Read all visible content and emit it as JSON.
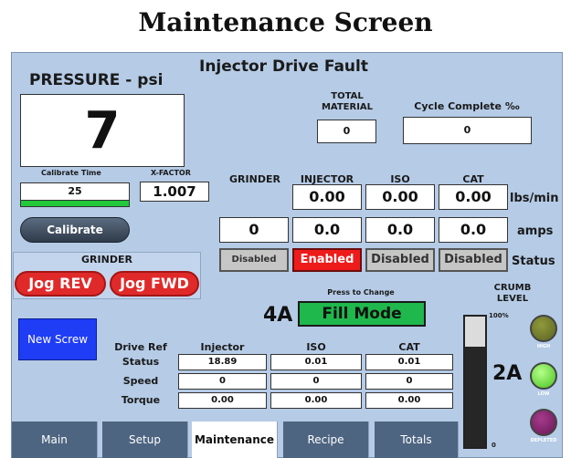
{
  "page_title": "Maintenance Screen",
  "fault": "Injector Drive Fault",
  "pressure": {
    "label": "PRESSURE - psi",
    "value": "7"
  },
  "calibrate_time": {
    "label": "Calibrate Time",
    "value": "25"
  },
  "xfactor": {
    "label": "X-FACTOR",
    "value": "1.007"
  },
  "calibrate_button": "Calibrate",
  "total_material": {
    "label_line1": "TOTAL",
    "label_line2": "MATERIAL",
    "value": "0"
  },
  "cycle_complete": {
    "label": "Cycle Complete ‰",
    "value": "0"
  },
  "columns": [
    "GRINDER",
    "INJECTOR",
    "ISO",
    "CAT"
  ],
  "rates": {
    "injector": "0.00",
    "iso": "0.00",
    "cat": "0.00",
    "unit": "lbs/min"
  },
  "amps": {
    "grinder": "0",
    "injector": "0.0",
    "iso": "0.0",
    "cat": "0.0",
    "unit": "amps"
  },
  "statuses": {
    "grinder": "Disabled",
    "injector": "Enabled",
    "iso": "Disabled",
    "cat": "Disabled",
    "label": "Status"
  },
  "grinder_panel": {
    "title": "GRINDER",
    "jog_rev": "Jog REV",
    "jog_fwd": "Jog FWD"
  },
  "press_to_change": "Press to Change",
  "mode_button": "Fill Mode",
  "callouts": {
    "a4": "4A",
    "a2": "2A"
  },
  "crumb": {
    "label_line1": "CRUMB",
    "label_line2": "LEVEL",
    "top": "100%",
    "bottom": "0",
    "fill_fraction": 0.77,
    "high": "HIGH",
    "low": "LOW",
    "depleted": "DEPLETED"
  },
  "new_screw": "New Screw",
  "drive_table": {
    "corner": "Drive Ref",
    "headers": [
      "Injector",
      "ISO",
      "CAT"
    ],
    "rows": [
      {
        "label": "Status",
        "values": [
          "18.89",
          "0.01",
          "0.01"
        ]
      },
      {
        "label": "Speed",
        "values": [
          "0",
          "0",
          "0"
        ]
      },
      {
        "label": "Torque",
        "values": [
          "0.00",
          "0.00",
          "0.00"
        ]
      }
    ]
  },
  "tabs": [
    "Main",
    "Setup",
    "Maintenance",
    "Recipe",
    "Totals"
  ],
  "colors": {
    "panel": "#b5cbe6",
    "enabled": "#ee1b1b",
    "mode_button": "#1fb84c",
    "low_light": "#6ef04a"
  }
}
